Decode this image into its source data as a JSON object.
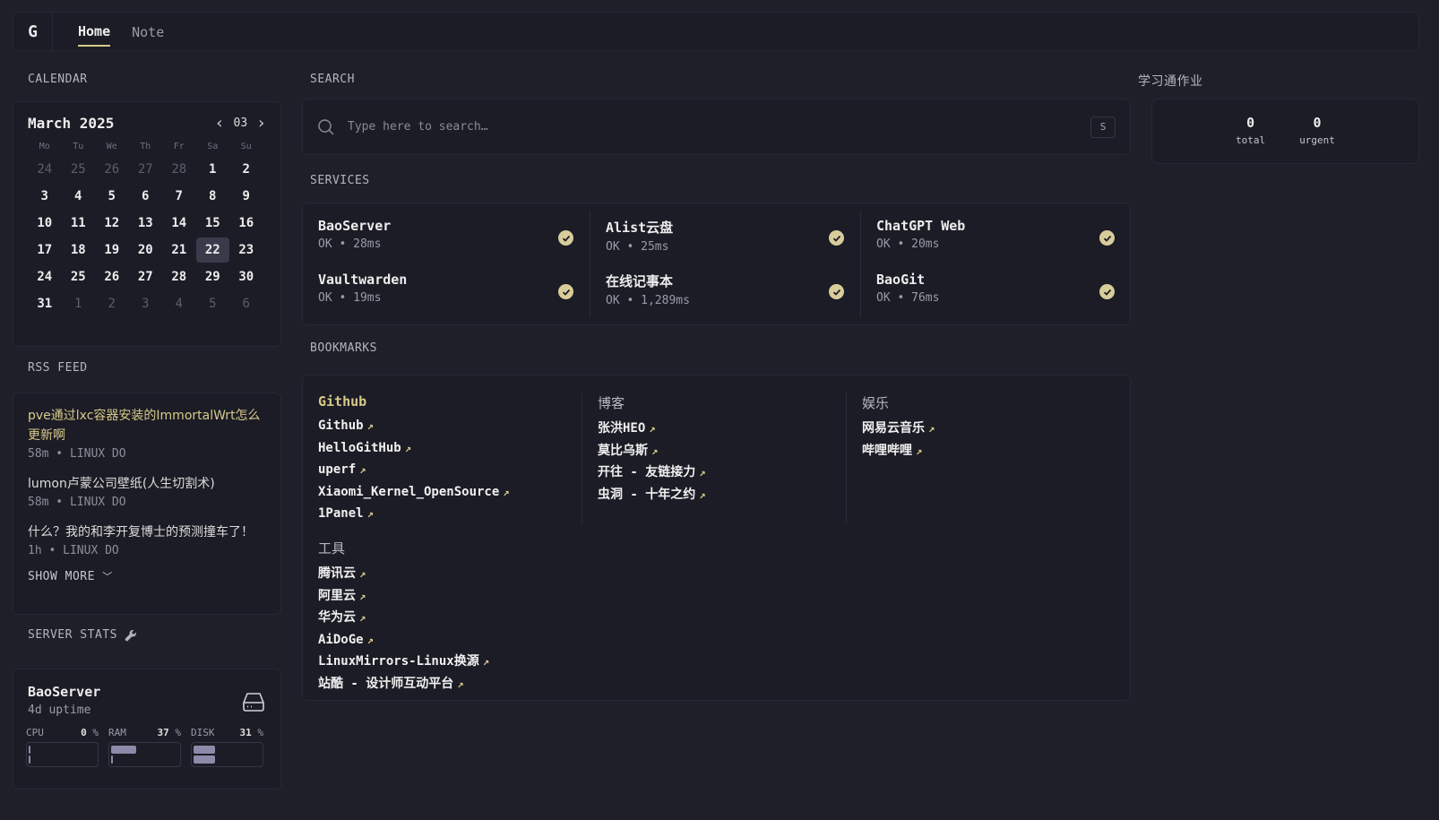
{
  "nav": {
    "logo": "G",
    "tabs": [
      "Home",
      "Note"
    ]
  },
  "sections": {
    "calendar": "CALENDAR",
    "search": "SEARCH",
    "services": "SERVICES",
    "bookmarks": "BOOKMARKS",
    "rss": "RSS FEED",
    "server_stats": "SERVER STATS",
    "homework": "学习通作业"
  },
  "calendar": {
    "title": "March 2025",
    "month_num": "03",
    "weekdays": [
      "Mo",
      "Tu",
      "We",
      "Th",
      "Fr",
      "Sa",
      "Su"
    ],
    "days": [
      {
        "d": "24",
        "m": true
      },
      {
        "d": "25",
        "m": true
      },
      {
        "d": "26",
        "m": true
      },
      {
        "d": "27",
        "m": true
      },
      {
        "d": "28",
        "m": true
      },
      {
        "d": "1"
      },
      {
        "d": "2"
      },
      {
        "d": "3"
      },
      {
        "d": "4"
      },
      {
        "d": "5"
      },
      {
        "d": "6"
      },
      {
        "d": "7"
      },
      {
        "d": "8"
      },
      {
        "d": "9"
      },
      {
        "d": "10"
      },
      {
        "d": "11"
      },
      {
        "d": "12"
      },
      {
        "d": "13"
      },
      {
        "d": "14"
      },
      {
        "d": "15"
      },
      {
        "d": "16"
      },
      {
        "d": "17"
      },
      {
        "d": "18"
      },
      {
        "d": "19"
      },
      {
        "d": "20"
      },
      {
        "d": "21"
      },
      {
        "d": "22",
        "t": true
      },
      {
        "d": "23"
      },
      {
        "d": "24"
      },
      {
        "d": "25"
      },
      {
        "d": "26"
      },
      {
        "d": "27"
      },
      {
        "d": "28"
      },
      {
        "d": "29"
      },
      {
        "d": "30"
      },
      {
        "d": "31"
      },
      {
        "d": "1",
        "m": true
      },
      {
        "d": "2",
        "m": true
      },
      {
        "d": "3",
        "m": true
      },
      {
        "d": "4",
        "m": true
      },
      {
        "d": "5",
        "m": true
      },
      {
        "d": "6",
        "m": true
      }
    ]
  },
  "rss": {
    "items": [
      {
        "title": "pve通过lxc容器安装的ImmortalWrt怎么更新啊",
        "meta": "58m • LINUX DO",
        "highlight": true
      },
      {
        "title": "lumon卢蒙公司壁纸(人生切割术)",
        "meta": "58m • LINUX DO"
      },
      {
        "title": "什么？我的和李开复博士的预测撞车了！",
        "meta": "1h • LINUX DO"
      }
    ],
    "show_more": "SHOW MORE"
  },
  "server": {
    "name": "BaoServer",
    "uptime": "4d uptime",
    "meters": [
      {
        "label": "CPU",
        "value": "0",
        "unit": "%",
        "fill": [
          0,
          0
        ]
      },
      {
        "label": "RAM",
        "value": "37",
        "unit": "%",
        "fill": [
          0.37,
          0
        ]
      },
      {
        "label": "DISK",
        "value": "31",
        "unit": "%",
        "fill": [
          0.31,
          0.31
        ]
      }
    ]
  },
  "search": {
    "placeholder": "Type here to search…",
    "shortcut": "S"
  },
  "services": [
    {
      "name": "BaoServer",
      "meta": "OK • 28ms"
    },
    {
      "name": "Alist云盘",
      "meta": "OK • 25ms"
    },
    {
      "name": "ChatGPT Web",
      "meta": "OK • 20ms"
    },
    {
      "name": "Vaultwarden",
      "meta": "OK • 19ms"
    },
    {
      "name": "在线记事本",
      "meta": "OK • 1,289ms"
    },
    {
      "name": "BaoGit",
      "meta": "OK • 76ms"
    }
  ],
  "bookmarks": {
    "github": {
      "title": "Github",
      "links": [
        "Github",
        "HelloGitHub",
        "uperf",
        "Xiaomi_Kernel_OpenSource",
        "1Panel"
      ]
    },
    "blog": {
      "title": "博客",
      "links": [
        "张洪HEO",
        "莫比乌斯",
        "开往 - 友链接力",
        "虫洞 - 十年之约"
      ]
    },
    "fun": {
      "title": "娱乐",
      "links": [
        "网易云音乐",
        "哔哩哔哩"
      ]
    },
    "tools": {
      "title": "工具",
      "links": [
        "腾讯云",
        "阿里云",
        "华为云",
        "AiDoGe",
        "LinuxMirrors-Linux换源",
        "站酷 - 设计师互动平台"
      ]
    }
  },
  "homework": {
    "total": "0",
    "total_label": "total",
    "urgent": "0",
    "urgent_label": "urgent"
  },
  "colors": {
    "accent": "#d8c98a",
    "background": "#1e1f29",
    "card": "#1b1c25"
  }
}
